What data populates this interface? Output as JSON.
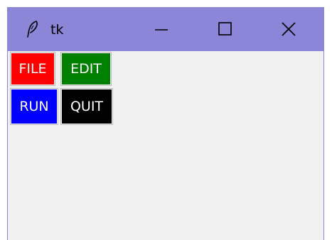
{
  "window": {
    "title": "tk",
    "titlebar_color": "#8c86d8",
    "background_color": "#f0f0f0",
    "app_icon": "feather-icon",
    "controls": {
      "minimize_icon": "minimize-icon",
      "maximize_icon": "maximize-icon",
      "close_icon": "close-icon"
    }
  },
  "buttons": {
    "file": {
      "label": "FILE",
      "bg": "#ff0000"
    },
    "edit": {
      "label": "EDIT",
      "bg": "#008000"
    },
    "run": {
      "label": "RUN",
      "bg": "#0000ff"
    },
    "quit": {
      "label": "QUIT",
      "bg": "#000000"
    }
  }
}
